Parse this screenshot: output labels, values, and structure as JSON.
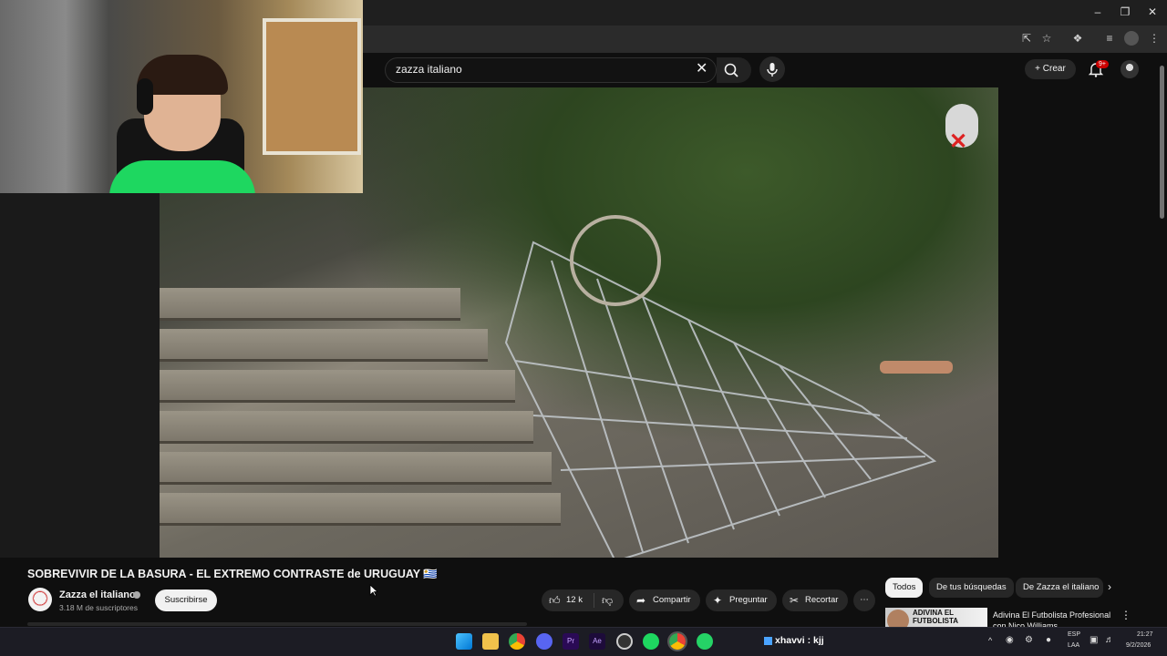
{
  "youtube": {
    "search": {
      "value": "zazza italiano"
    },
    "create_label": "Crear",
    "notification_badge": "9+"
  },
  "video": {
    "title": "SOBREVIVIR DE LA BASURA - EL EXTREMO CONTRASTE de URUGUAY 🇺🇾",
    "channel_name": "Zazza el italiano",
    "subscribers": "3.18 M de suscriptores",
    "subscribe_label": "Suscribirse",
    "likes": "12 k",
    "share_label": "Compartir",
    "ask_label": "Preguntar",
    "clip_label": "Recortar"
  },
  "chips": [
    "Todos",
    "De tus búsquedas",
    "De Zazza el italiano"
  ],
  "recommendation": {
    "thumb_text": "ADIVINA EL FUTBOLISTA",
    "title": "Adivina El Futbolista Profesional con Nico Williams"
  },
  "taskbar": {
    "tray_user": "xhavvi : kjj",
    "lang_top": "ESP",
    "lang_bottom": "LAA",
    "time": "21:27",
    "date": "9/2/2026"
  },
  "colors": {
    "accent_green": "#1ed760",
    "badge_red": "#cc0000"
  }
}
